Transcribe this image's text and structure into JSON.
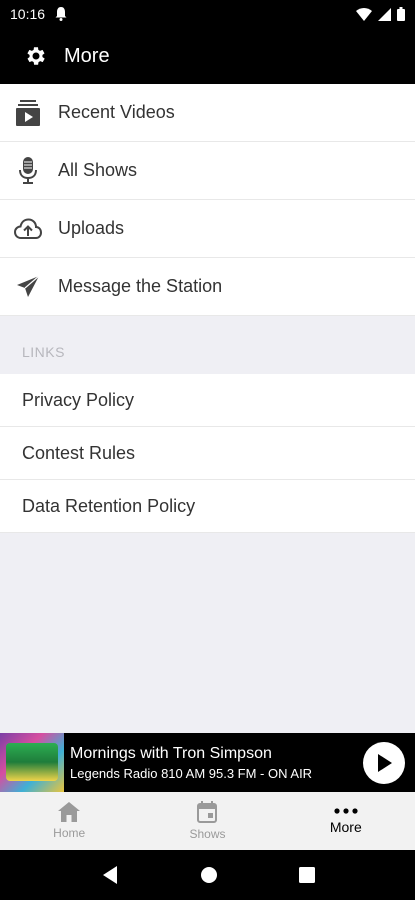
{
  "status_bar": {
    "time": "10:16"
  },
  "app_bar": {
    "title": "More"
  },
  "menu_items": [
    {
      "label": "Recent Videos",
      "icon": "video-library-icon"
    },
    {
      "label": "All Shows",
      "icon": "microphone-icon"
    },
    {
      "label": "Uploads",
      "icon": "cloud-upload-icon"
    },
    {
      "label": "Message the Station",
      "icon": "send-icon"
    }
  ],
  "links_section": {
    "header": "LINKS",
    "items": [
      "Privacy Policy",
      "Contest Rules",
      "Data Retention Policy"
    ]
  },
  "player": {
    "show_title": "Mornings with Tron Simpson",
    "station_info": "Legends Radio 810 AM 95.3 FM - ON AIR"
  },
  "tabs": [
    {
      "label": "Home",
      "icon": "home-icon",
      "active": false
    },
    {
      "label": "Shows",
      "icon": "calendar-icon",
      "active": false
    },
    {
      "label": "More",
      "icon": "more-horizontal-icon",
      "active": true
    }
  ],
  "colors": {
    "bar": "#000000",
    "background": "#efeff4",
    "inactive_tab": "#9a9a9a"
  }
}
